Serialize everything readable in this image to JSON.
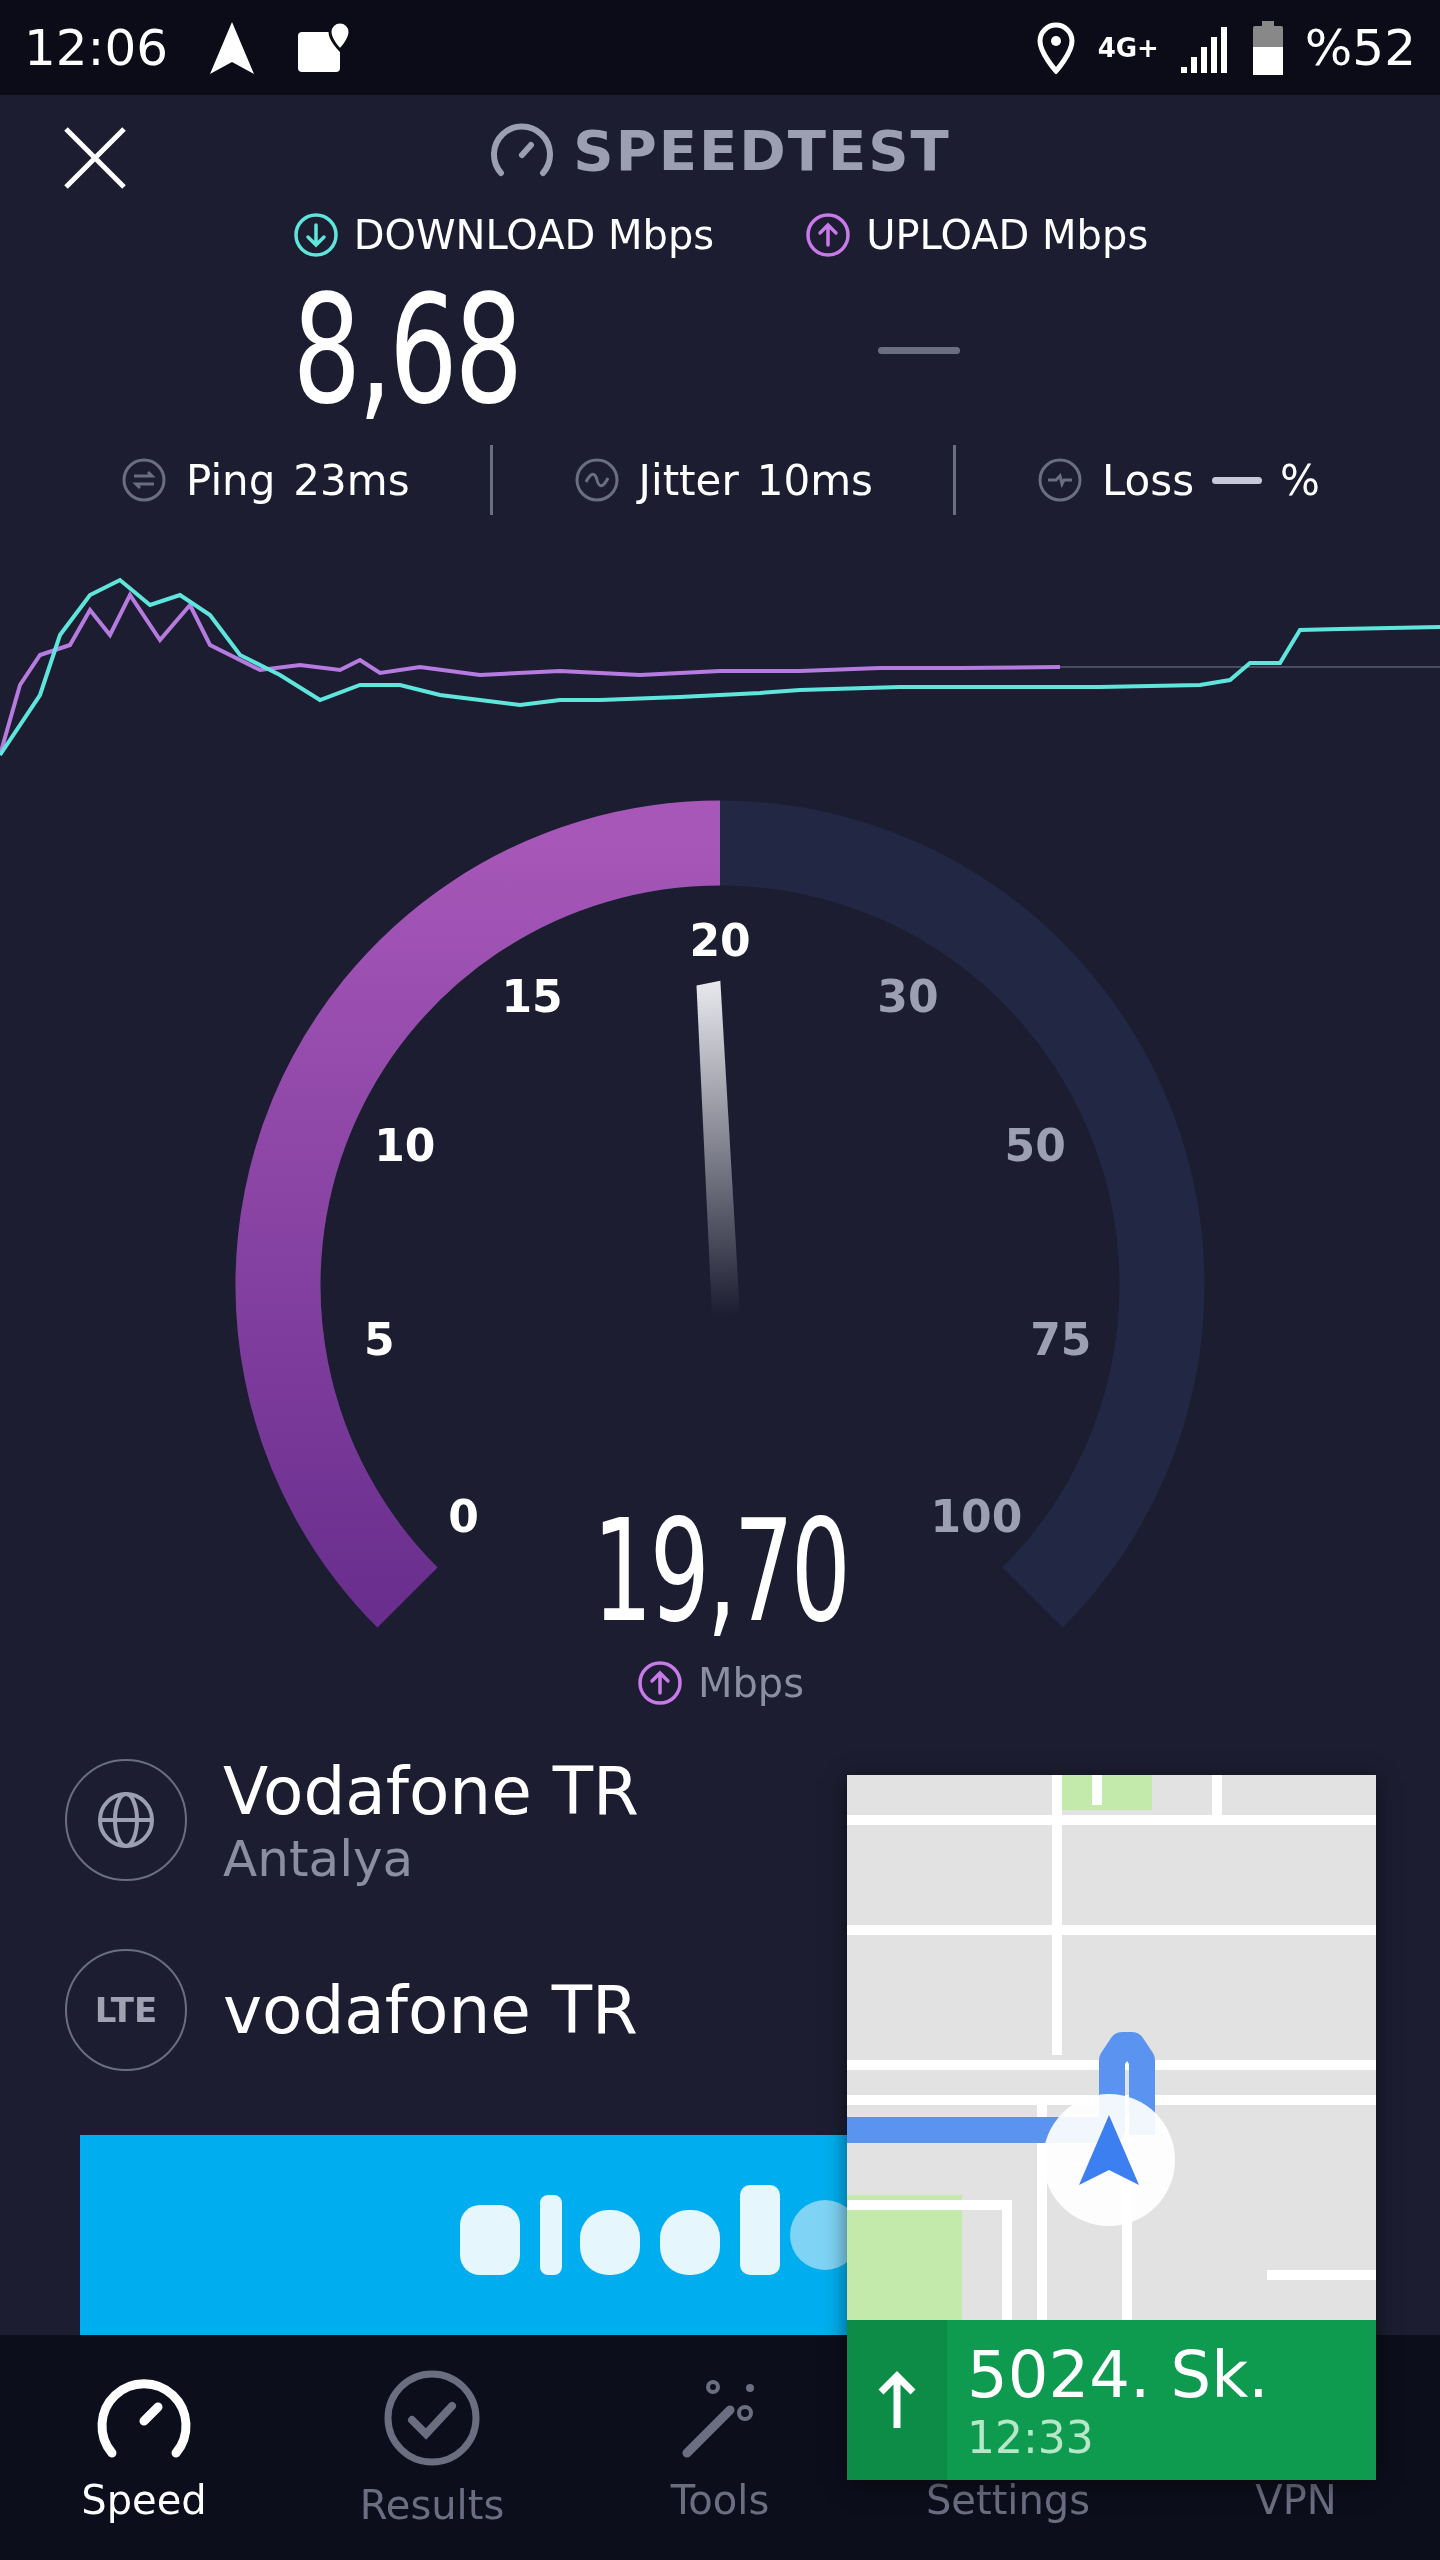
{
  "status_bar": {
    "time": "12:06",
    "network": "4G+",
    "battery": "%52"
  },
  "header": {
    "title": "SPEEDTEST"
  },
  "download": {
    "label": "DOWNLOAD Mbps",
    "value": "8,68"
  },
  "upload": {
    "label": "UPLOAD Mbps"
  },
  "stats": [
    {
      "kind": "ping",
      "label": "Ping",
      "value": "23ms"
    },
    {
      "kind": "jitter",
      "label": "Jitter",
      "value": "10ms"
    },
    {
      "kind": "loss",
      "label": "Loss",
      "value": "%"
    }
  ],
  "gauge": {
    "value": "19,70",
    "unit": "Mbps",
    "ticks": [
      {
        "label": "0",
        "passed": true
      },
      {
        "label": "5",
        "passed": true
      },
      {
        "label": "10",
        "passed": true
      },
      {
        "label": "15",
        "passed": true
      },
      {
        "label": "20",
        "passed": true
      },
      {
        "label": "30",
        "passed": false
      },
      {
        "label": "50",
        "passed": false
      },
      {
        "label": "75",
        "passed": false
      },
      {
        "label": "100",
        "passed": false
      }
    ]
  },
  "providers": [
    {
      "kind": "isp",
      "name": "Vodafone TR",
      "location": "Antalya"
    },
    {
      "kind": "lte",
      "badge": "LTE",
      "name": "vodafone TR"
    }
  ],
  "nav": [
    {
      "kind": "speed",
      "label": "Speed",
      "selected": true
    },
    {
      "kind": "results",
      "label": "Results",
      "selected": false
    },
    {
      "kind": "tools",
      "label": "Tools",
      "selected": false
    },
    {
      "kind": "settings",
      "label": "Settings",
      "selected": false
    },
    {
      "kind": "vpn",
      "label": "VPN",
      "selected": false
    }
  ],
  "navigation_overlay": {
    "street": "5024. Sk.",
    "eta": "12:33"
  }
}
